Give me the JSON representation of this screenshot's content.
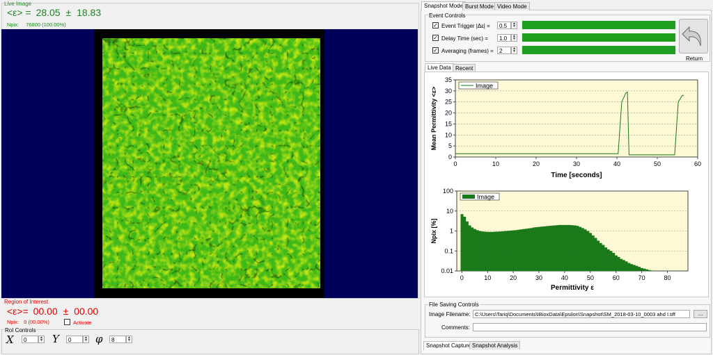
{
  "live_image": {
    "group_label": "Live Image",
    "eps_label": "<ε> =",
    "eps_value": "28.05",
    "pm": "±",
    "eps_error": "18.83",
    "npix_label": "Npix:",
    "npix_value": "76800 (100.00%)"
  },
  "roi": {
    "group_label": "Region of Interest",
    "eps_label": "<ε>=",
    "eps_value": "00.00",
    "pm": "±",
    "eps_error": "00.00",
    "npix_label": "Npix:",
    "npix_value": "0 (00.00%)",
    "activate_label": "Activate",
    "controls_label": "RoI Controls",
    "x_symbol": "X",
    "x_value": "0",
    "y_symbol": "Y",
    "y_value": "0",
    "phi_symbol": "φ",
    "phi_value": "8"
  },
  "mode_tabs": [
    "Snapshot Mode",
    "Burst Mode",
    "Video Mode"
  ],
  "event_controls": {
    "group_label": "Event Controls",
    "rows": [
      {
        "label": "Event Trigger |Δε| =",
        "value": "0.5",
        "checked": true
      },
      {
        "label": "Delay Time (sec) =",
        "value": "1.0",
        "checked": true
      },
      {
        "label": "Averaging (frames) =",
        "value": "2",
        "checked": true
      }
    ],
    "return_label": "Return",
    "bar_color": "#1e9e1e"
  },
  "data_tabs": [
    "Live Data",
    "Recent"
  ],
  "file_saving": {
    "group_label": "File Saving Controls",
    "filename_label": "Image Filename:",
    "filename_value": "C:\\Users\\Tariq\\Documents\\IBioxData\\Epsilon\\Snapshot\\SM_2018-03-10_0003 ahd I.tiff",
    "browse_label": "...",
    "comments_label": "Comments:",
    "comments_value": ""
  },
  "bottom_tabs": [
    "Snapshot Capture",
    "Snapshot Analysis"
  ],
  "chart_data": [
    {
      "type": "line",
      "legend": [
        "Image"
      ],
      "xlabel": "Time [seconds]",
      "ylabel": "Mean Permittivity <ε>",
      "xlim": [
        0,
        60
      ],
      "ylim": [
        0,
        35
      ],
      "xticks": [
        0,
        10,
        20,
        30,
        40,
        50,
        60
      ],
      "yticks": [
        0,
        5,
        10,
        15,
        20,
        25,
        30,
        35
      ],
      "grid": true,
      "legend_position": "top-left",
      "series": [
        {
          "name": "Image",
          "x": [
            0,
            40.3,
            41.2,
            42.2,
            42.6,
            43,
            54.3,
            55.2,
            56.2,
            56.6
          ],
          "y": [
            1.5,
            1.5,
            25,
            29,
            29.5,
            1,
            1,
            25,
            28,
            28
          ]
        }
      ]
    },
    {
      "type": "bar",
      "legend": [
        "Image"
      ],
      "xlabel": "Permittivity ε",
      "ylabel": "Npix [%]",
      "xlim": [
        -2,
        88
      ],
      "ylim": [
        0.01,
        100
      ],
      "yscale": "log",
      "xticks": [
        0,
        10,
        20,
        30,
        40,
        50,
        60,
        70,
        80
      ],
      "yticks": [
        "0.01",
        "0.1",
        "1",
        "10",
        "100"
      ],
      "grid": true,
      "legend_position": "top-left",
      "series": [
        {
          "name": "Image",
          "x": [
            0,
            1,
            2,
            3,
            4,
            5,
            6,
            7,
            8,
            9,
            10,
            11,
            12,
            13,
            14,
            15,
            16,
            17,
            18,
            19,
            20,
            21,
            22,
            23,
            24,
            25,
            26,
            27,
            28,
            29,
            30,
            31,
            32,
            33,
            34,
            35,
            36,
            37,
            38,
            39,
            40,
            41,
            42,
            43,
            44,
            45,
            46,
            47,
            48,
            49,
            50,
            51,
            52,
            53,
            54,
            55,
            56,
            57,
            58,
            59,
            60,
            61,
            62,
            63,
            64,
            65,
            66,
            67,
            68,
            69,
            70,
            71,
            72,
            73,
            74
          ],
          "y": [
            7,
            5.2,
            3,
            1.9,
            1.5,
            1.25,
            1.1,
            1.0,
            0.95,
            0.92,
            0.9,
            0.9,
            0.9,
            0.92,
            0.93,
            0.95,
            0.97,
            1.0,
            1.02,
            1.05,
            1.08,
            1.1,
            1.15,
            1.2,
            1.25,
            1.3,
            1.35,
            1.4,
            1.5,
            1.55,
            1.6,
            1.65,
            1.7,
            1.75,
            1.8,
            1.85,
            1.9,
            1.95,
            2.0,
            2.0,
            2.0,
            2.0,
            2.0,
            1.95,
            1.9,
            1.8,
            1.6,
            1.4,
            1.2,
            1.0,
            0.8,
            0.6,
            0.45,
            0.33,
            0.25,
            0.2,
            0.15,
            0.12,
            0.1,
            0.08,
            0.06,
            0.05,
            0.04,
            0.035,
            0.03,
            0.025,
            0.022,
            0.02,
            0.018,
            0.016,
            0.014,
            0.013,
            0.012,
            0.011,
            0.0105
          ]
        }
      ]
    }
  ]
}
